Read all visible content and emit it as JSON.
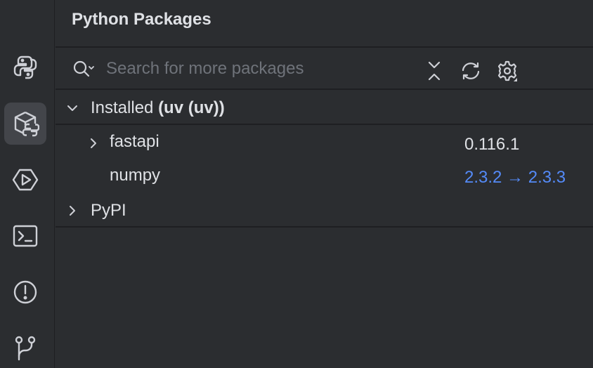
{
  "panel": {
    "title": "Python Packages"
  },
  "search": {
    "placeholder": "Search for more packages",
    "value": ""
  },
  "sidebar": {
    "items": [
      {
        "icon": "python-icon",
        "active": false
      },
      {
        "icon": "python-packages-icon",
        "active": true
      },
      {
        "icon": "run-services-icon",
        "active": false
      },
      {
        "icon": "terminal-icon",
        "active": false
      },
      {
        "icon": "problems-icon",
        "active": false
      },
      {
        "icon": "git-branch-icon",
        "active": false
      }
    ]
  },
  "toolbar": {
    "icons": [
      "collapse-all-icon",
      "refresh-icon",
      "settings-icon"
    ]
  },
  "installed": {
    "label": "Installed",
    "interpreter": "(uv (uv))",
    "packages": [
      {
        "name": "fastapi",
        "version": "0.116.1",
        "expandable": true
      },
      {
        "name": "numpy",
        "version": "2.3.2 → 2.3.3",
        "expandable": false,
        "upgrade_available": true
      }
    ]
  },
  "repositories": [
    {
      "name": "PyPI"
    }
  ],
  "colors": {
    "background": "#2b2d30",
    "text": "#dfe1e5",
    "muted": "#6f737a",
    "upgrade": "#548af7",
    "active_item": "#43454a"
  }
}
